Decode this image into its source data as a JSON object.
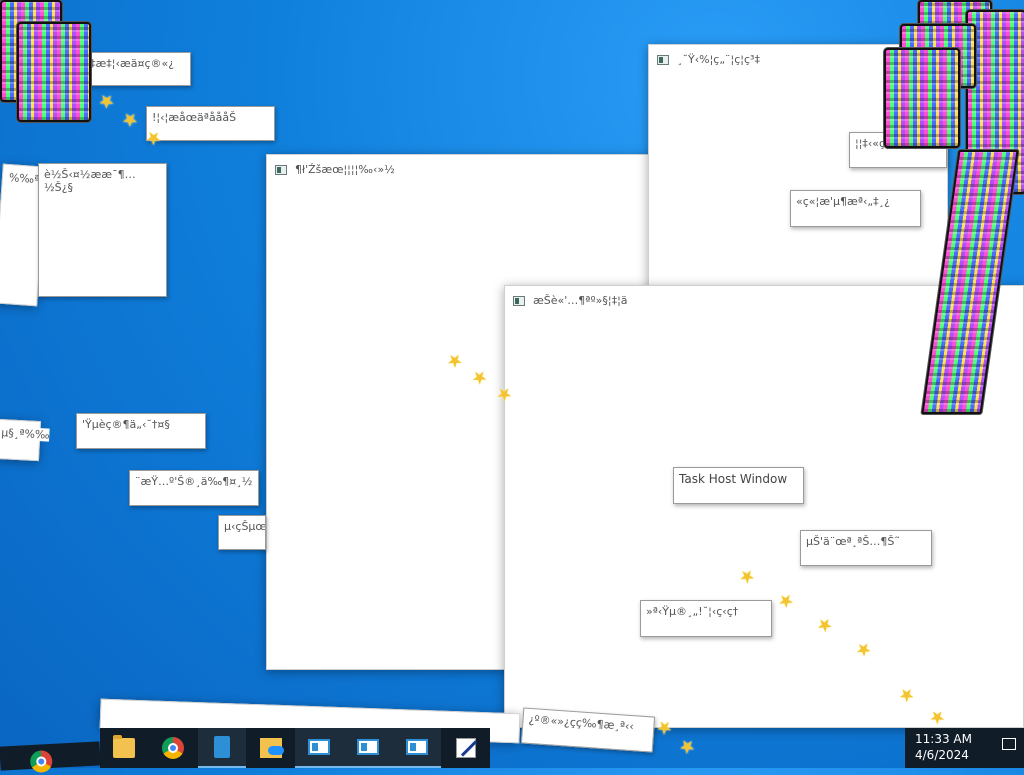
{
  "windows": {
    "w_center_title": "¶ł'Źšæœ¦¦¦¦‰‹»½",
    "w_right_title": "¸˘Ÿ‹%¦ç„¨¦ç¦ç³‡",
    "w_front_title": "æŠè«'…¶ªº»§¦‡¦ä"
  },
  "tooltips": {
    "t1": "‡æ‡¦‹æä¤ç®«¿",
    "t2": "!¦‹¦æåœäªåååŠ",
    "t3": "è½Š‹¤½ææ¯¶…½Š¿§",
    "t4": "%‰ª‹µ",
    "t5": "'Ÿµèç®¶ä„‹˘†¤§",
    "t6": "¨æŸ…º'Š®¸ä‰¶¤¸½",
    "t7": "µ‹çŠµœ'",
    "t8": "µ§¸ª%‰",
    "t9": "¦¦‡‹«ç¸œ˘ç¸¸‚",
    "t10": "«ç«¦æ'µ¶æª‹„‡¸¿",
    "task_host": "Task Host Window",
    "t11": "µŠ'ä¨œª¸ªŠ…¶Š˜",
    "t12": "»ª‹Ÿµ®¸„!˘¦‹ç‹ç†",
    "t13": "¿º®«»¿çç‰¶æ¸ª‹‹"
  },
  "taskbar": {
    "apps": [
      "file-explorer",
      "chrome",
      "tablet-app",
      "onedrive-folder",
      "app-window-1",
      "app-window-2",
      "app-window-3",
      "paint"
    ],
    "time": "11:33 AM",
    "date": "4/6/2024"
  },
  "colors": {
    "desktop": "#0f7fdc",
    "taskbar": "#101c28",
    "star": "#f4c430"
  }
}
